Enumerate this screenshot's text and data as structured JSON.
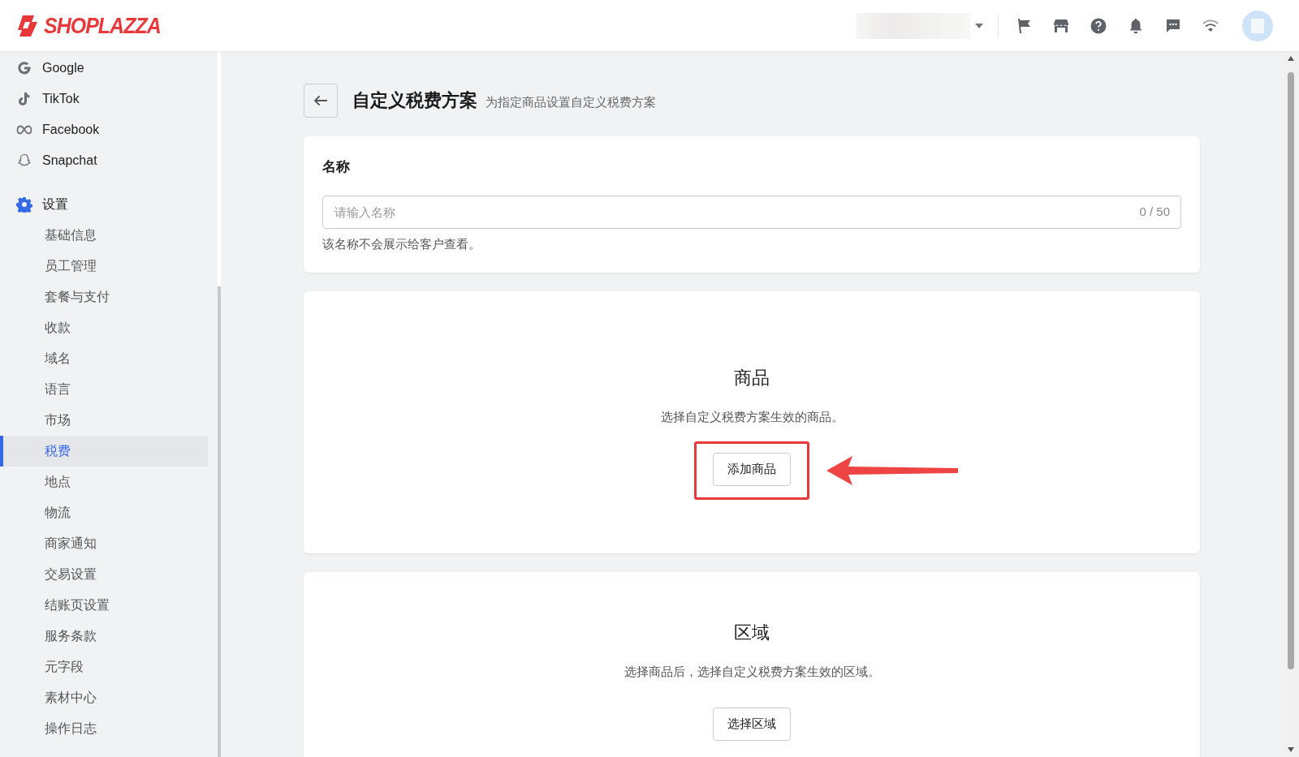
{
  "header": {
    "logo": "SHOPLAZZA"
  },
  "sidebar": {
    "channels": [
      {
        "label": "Google",
        "kind": "google"
      },
      {
        "label": "TikTok",
        "kind": "tiktok"
      },
      {
        "label": "Facebook",
        "kind": "meta"
      },
      {
        "label": "Snapchat",
        "kind": "snapchat"
      }
    ],
    "settings": {
      "label": "设置",
      "items": [
        {
          "label": "基础信息",
          "selected": false
        },
        {
          "label": "员工管理",
          "selected": false
        },
        {
          "label": "套餐与支付",
          "selected": false
        },
        {
          "label": "收款",
          "selected": false
        },
        {
          "label": "域名",
          "selected": false
        },
        {
          "label": "语言",
          "selected": false
        },
        {
          "label": "市场",
          "selected": false
        },
        {
          "label": "税费",
          "selected": true
        },
        {
          "label": "地点",
          "selected": false
        },
        {
          "label": "物流",
          "selected": false
        },
        {
          "label": "商家通知",
          "selected": false
        },
        {
          "label": "交易设置",
          "selected": false
        },
        {
          "label": "结账页设置",
          "selected": false
        },
        {
          "label": "服务条款",
          "selected": false
        },
        {
          "label": "元字段",
          "selected": false
        },
        {
          "label": "素材中心",
          "selected": false
        },
        {
          "label": "操作日志",
          "selected": false
        }
      ]
    }
  },
  "page": {
    "title": "自定义税费方案",
    "subtitle": "为指定商品设置自定义税费方案"
  },
  "name_card": {
    "heading": "名称",
    "placeholder": "请输入名称",
    "counter": "0 / 50",
    "help": "该名称不会展示给客户查看。"
  },
  "sections": [
    {
      "title": "商品",
      "description": "选择自定义税费方案生效的商品。",
      "button": "添加商品",
      "highlighted": true
    },
    {
      "title": "区域",
      "description": "选择商品后，选择自定义税费方案生效的区域。",
      "button": "选择区域",
      "highlighted": false
    }
  ]
}
